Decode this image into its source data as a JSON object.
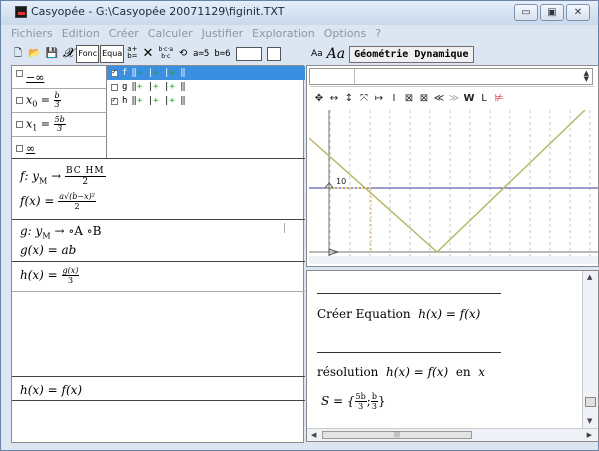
{
  "window": {
    "title": "Casyopée - G:\\Casyopée 20071129\\figinit.TXT",
    "minimize": "▭",
    "maximize": "▣",
    "close": "✕"
  },
  "menu": [
    "Fichiers",
    "Edition",
    "Créer",
    "Calculer",
    "Justifier",
    "Exploration",
    "Options",
    "?"
  ],
  "toolbar_left": {
    "new": "🗋",
    "open": "📂",
    "save": "💾",
    "x_symbol": "𝓧",
    "fonc": "Fonc",
    "equa": "Equa",
    "t_button": "a+\nb=",
    "delete": "✕",
    "calc": "b·c·a\nb·c",
    "icon6": "⟲",
    "a_param": "a=5",
    "b_param": "b=6"
  },
  "toolbar_right": {
    "aa_small": "Aa",
    "aa_big": "Aa",
    "geo_button": "Géométrie Dynamique"
  },
  "variables": [
    {
      "label": "−∞"
    },
    {
      "label_prefix": "x",
      "sub": "0",
      "num": "b",
      "den": "3"
    },
    {
      "label_prefix": "x",
      "sub": "1",
      "num": "5b",
      "den": "3"
    },
    {
      "label": "∞"
    }
  ],
  "functions": [
    {
      "name": "f",
      "checked": true,
      "selected": true
    },
    {
      "name": "g",
      "checked": false,
      "selected": false
    },
    {
      "name": "h",
      "checked": true,
      "selected": false
    }
  ],
  "expressions": {
    "f_def": "f:  y",
    "f_def_sub": "M",
    "f_def_arrow": " → ",
    "f_def_num": "BC  HM",
    "f_def_den": "2",
    "f_formula": "f(x) = ",
    "f_formula_num": "a√(b−x)²",
    "f_formula_den": "2",
    "g_def": "g:  y",
    "g_def_sub": "M",
    "g_def_rest": "→  ∘A  ∘B",
    "g_formula": "g(x) = ab",
    "h_formula": "h(x) = ",
    "h_formula_num": "g(x)",
    "h_formula_den": "3",
    "equation": "h(x) = f(x)"
  },
  "geometry_tools": [
    "✥",
    "↔",
    "↕",
    "⤧",
    "↦",
    "I",
    "⊠",
    "⊠",
    "≪",
    "≫",
    "W",
    "L",
    "⊭"
  ],
  "graph": {
    "y_label": "10"
  },
  "results": {
    "create_label": "Créer Equation",
    "create_formula": "h(x) = f(x)",
    "resolution_label": "résolution",
    "resolution_formula": "h(x) = f(x)",
    "resolution_en": "en",
    "resolution_var": "x",
    "solution_prefix": "S = {",
    "sol1_num": "5b",
    "sol1_den": "3",
    "sol2_num": "b",
    "sol2_den": "3",
    "solution_suffix": "}"
  },
  "colors": {
    "accent_blue": "#3a8fe0",
    "graph_line": "#b8b86a",
    "horizontal_line": "#3a3aa0"
  }
}
